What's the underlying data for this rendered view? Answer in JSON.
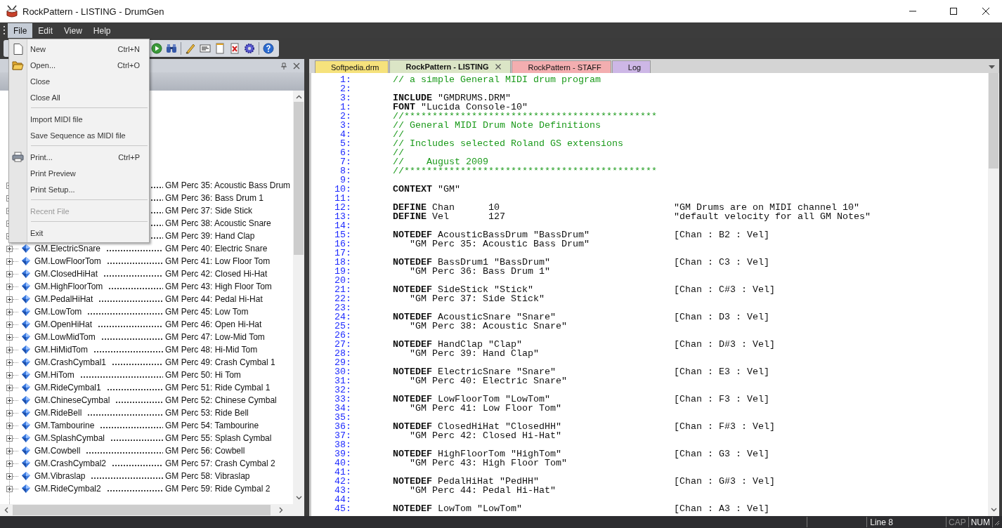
{
  "window": {
    "title": "RockPattern - LISTING - DrumGen"
  },
  "menubar": [
    {
      "label": "File",
      "selected": true
    },
    {
      "label": "Edit",
      "selected": false
    },
    {
      "label": "View",
      "selected": false
    },
    {
      "label": "Help",
      "selected": false
    }
  ],
  "file_menu": [
    {
      "kind": "item",
      "label": "New",
      "shortcut": "Ctrl+N",
      "disabled": false
    },
    {
      "kind": "item",
      "label": "Open...",
      "shortcut": "Ctrl+O",
      "disabled": false
    },
    {
      "kind": "item",
      "label": "Close",
      "disabled": false
    },
    {
      "kind": "item",
      "label": "Close All",
      "disabled": false
    },
    {
      "kind": "separator"
    },
    {
      "kind": "item",
      "label": "Import MIDI file",
      "disabled": false
    },
    {
      "kind": "item",
      "label": "Save Sequence as MIDI file",
      "disabled": false
    },
    {
      "kind": "separator"
    },
    {
      "kind": "item",
      "label": "Print...",
      "shortcut": "Ctrl+P",
      "disabled": false
    },
    {
      "kind": "item",
      "label": "Print Preview",
      "disabled": false
    },
    {
      "kind": "item",
      "label": "Print Setup...",
      "disabled": false
    },
    {
      "kind": "separator"
    },
    {
      "kind": "item",
      "label": "Recent File",
      "disabled": true
    },
    {
      "kind": "separator"
    },
    {
      "kind": "item",
      "label": "Exit",
      "disabled": false
    }
  ],
  "tree": {
    "items": [
      {
        "description": "GM Perc 35: Acoustic Bass Drum"
      },
      {
        "description": "GM Perc 36: Bass Drum 1"
      },
      {
        "description": "GM Perc 37: Side Stick"
      },
      {
        "description": "GM Perc 38: Acoustic Snare"
      },
      {
        "description": "GM Perc 39: Hand Clap"
      },
      {
        "name": "GM.ElectricSnare",
        "description": "GM Perc 40: Electric Snare"
      },
      {
        "name": "GM.LowFloorTom",
        "description": "GM Perc 41: Low Floor Tom"
      },
      {
        "name": "GM.ClosedHiHat",
        "description": "GM Perc 42: Closed Hi-Hat"
      },
      {
        "name": "GM.HighFloorTom",
        "description": "GM Perc 43: High Floor Tom"
      },
      {
        "name": "GM.PedalHiHat",
        "description": "GM Perc 44: Pedal Hi-Hat"
      },
      {
        "name": "GM.LowTom",
        "description": "GM Perc 45: Low Tom"
      },
      {
        "name": "GM.OpenHiHat",
        "description": "GM Perc 46: Open Hi-Hat"
      },
      {
        "name": "GM.LowMidTom",
        "description": "GM Perc 47: Low-Mid Tom"
      },
      {
        "name": "GM.HiMidTom",
        "description": "GM Perc 48: Hi-Mid Tom"
      },
      {
        "name": "GM.CrashCymbal1",
        "description": "GM Perc 49: Crash Cymbal 1"
      },
      {
        "name": "GM.HiTom",
        "description": "GM Perc 50: Hi Tom"
      },
      {
        "name": "GM.RideCymbal1",
        "description": "GM Perc 51: Ride Cymbal 1"
      },
      {
        "name": "GM.ChineseCymbal",
        "description": "GM Perc 52: Chinese Cymbal"
      },
      {
        "name": "GM.RideBell",
        "description": "GM Perc 53: Ride Bell"
      },
      {
        "name": "GM.Tambourine",
        "description": "GM Perc 54: Tambourine"
      },
      {
        "name": "GM.SplashCymbal",
        "description": "GM Perc 55: Splash Cymbal"
      },
      {
        "name": "GM.Cowbell",
        "description": "GM Perc 56: Cowbell"
      },
      {
        "name": "GM.CrashCymbal2",
        "description": "GM Perc 57: Crash Cymbal 2"
      },
      {
        "name": "GM.Vibraslap",
        "description": "GM Perc 58: Vibraslap"
      },
      {
        "name": "GM.RideCymbal2",
        "description": "GM Perc 59: Ride Cymbal 2"
      }
    ]
  },
  "tabs": [
    {
      "label": "Softpedia.drm",
      "selected": false,
      "color": "#f6e27c"
    },
    {
      "label": "RockPattern - LISTING",
      "selected": true,
      "color": "#dbe5c6"
    },
    {
      "label": "RockPattern - STAFF",
      "selected": false,
      "color": "#f3aeb0"
    },
    {
      "label": "Log",
      "selected": false,
      "color": "#cdb7e6"
    }
  ],
  "editor": {
    "lines": [
      {
        "num": "1:",
        "kind": "comment",
        "text": "// a simple General MIDI drum program"
      },
      {
        "num": "2:",
        "kind": "blank"
      },
      {
        "num": "3:",
        "kind": "code",
        "text": "**INCLUDE** \"GMDRUMS.DRM\""
      },
      {
        "num": "1:",
        "kind": "code",
        "text": "**FONT** \"Lucida Console-10\""
      },
      {
        "num": "2:",
        "kind": "comment",
        "text": "//*********************************************"
      },
      {
        "num": "3:",
        "kind": "comment",
        "text": "// General MIDI Drum Note Definitions"
      },
      {
        "num": "4:",
        "kind": "comment",
        "text": "//"
      },
      {
        "num": "5:",
        "kind": "comment",
        "text": "// Includes selected Roland GS extensions"
      },
      {
        "num": "6:",
        "kind": "comment",
        "text": "//"
      },
      {
        "num": "7:",
        "kind": "comment",
        "text": "//    August 2009"
      },
      {
        "num": "8:",
        "kind": "comment",
        "text": "//*********************************************"
      },
      {
        "num": "9:",
        "kind": "blank"
      },
      {
        "num": "10:",
        "kind": "code",
        "text": "**CONTEXT** \"GM\""
      },
      {
        "num": "11:",
        "kind": "blank"
      },
      {
        "num": "12:",
        "kind": "code",
        "text": "**DEFINE** Chan      10",
        "right": "\"GM Drums are on MIDI channel 10\""
      },
      {
        "num": "13:",
        "kind": "code",
        "text": "**DEFINE** Vel       127",
        "right": "\"default velocity for all GM Notes\""
      },
      {
        "num": "14:",
        "kind": "blank"
      },
      {
        "num": "15:",
        "kind": "code",
        "text": "**NOTEDEF** AcousticBassDrum \"BassDrum\"",
        "right": "[Chan : B2 : Vel]"
      },
      {
        "num": "16:",
        "kind": "continued",
        "text": "\"GM Perc 35: Acoustic Bass Drum\""
      },
      {
        "num": "17:",
        "kind": "blank"
      },
      {
        "num": "18:",
        "kind": "code",
        "text": "**NOTEDEF** BassDrum1 \"BassDrum\"",
        "right": "[Chan : C3 : Vel]"
      },
      {
        "num": "19:",
        "kind": "continued",
        "text": "\"GM Perc 36: Bass Drum 1\""
      },
      {
        "num": "20:",
        "kind": "blank"
      },
      {
        "num": "21:",
        "kind": "code",
        "text": "**NOTEDEF** SideStick \"Stick\"",
        "right": "[Chan : C#3 : Vel]"
      },
      {
        "num": "22:",
        "kind": "continued",
        "text": "\"GM Perc 37: Side Stick\""
      },
      {
        "num": "23:",
        "kind": "blank"
      },
      {
        "num": "24:",
        "kind": "code",
        "text": "**NOTEDEF** AcousticSnare \"Snare\"",
        "right": "[Chan : D3 : Vel]"
      },
      {
        "num": "25:",
        "kind": "continued",
        "text": "\"GM Perc 38: Acoustic Snare\""
      },
      {
        "num": "26:",
        "kind": "blank"
      },
      {
        "num": "27:",
        "kind": "code",
        "text": "**NOTEDEF** HandClap \"Clap\"",
        "right": "[Chan : D#3 : Vel]"
      },
      {
        "num": "28:",
        "kind": "continued",
        "text": "\"GM Perc 39: Hand Clap\""
      },
      {
        "num": "29:",
        "kind": "blank"
      },
      {
        "num": "30:",
        "kind": "code",
        "text": "**NOTEDEF** ElectricSnare \"Snare\"",
        "right": "[Chan : E3 : Vel]"
      },
      {
        "num": "31:",
        "kind": "continued",
        "text": "\"GM Perc 40: Electric Snare\""
      },
      {
        "num": "32:",
        "kind": "blank"
      },
      {
        "num": "33:",
        "kind": "code",
        "text": "**NOTEDEF** LowFloorTom \"LowTom\"",
        "right": "[Chan : F3 : Vel]"
      },
      {
        "num": "34:",
        "kind": "continued",
        "text": "\"GM Perc 41: Low Floor Tom\""
      },
      {
        "num": "35:",
        "kind": "blank"
      },
      {
        "num": "36:",
        "kind": "code",
        "text": "**NOTEDEF** ClosedHiHat \"ClosedHH\"",
        "right": "[Chan : F#3 : Vel]"
      },
      {
        "num": "37:",
        "kind": "continued",
        "text": "\"GM Perc 42: Closed Hi-Hat\""
      },
      {
        "num": "38:",
        "kind": "blank"
      },
      {
        "num": "39:",
        "kind": "code",
        "text": "**NOTEDEF** HighFloorTom \"HighTom\"",
        "right": "[Chan : G3 : Vel]"
      },
      {
        "num": "40:",
        "kind": "continued",
        "text": "\"GM Perc 43: High Floor Tom\""
      },
      {
        "num": "41:",
        "kind": "blank"
      },
      {
        "num": "42:",
        "kind": "code",
        "text": "**NOTEDEF** PedalHiHat \"PedHH\"",
        "right": "[Chan : G#3 : Vel]"
      },
      {
        "num": "43:",
        "kind": "continued",
        "text": "\"GM Perc 44: Pedal Hi-Hat\""
      },
      {
        "num": "44:",
        "kind": "blank"
      },
      {
        "num": "45:",
        "kind": "code",
        "text": "**NOTEDEF** LowTom \"LowTom\"",
        "right": "[Chan : A3 : Vel]"
      }
    ]
  },
  "status_bar": [
    {
      "text": "Line 8"
    },
    {
      "text": "CAP",
      "on": false
    },
    {
      "text": "NUM",
      "on": true
    }
  ]
}
